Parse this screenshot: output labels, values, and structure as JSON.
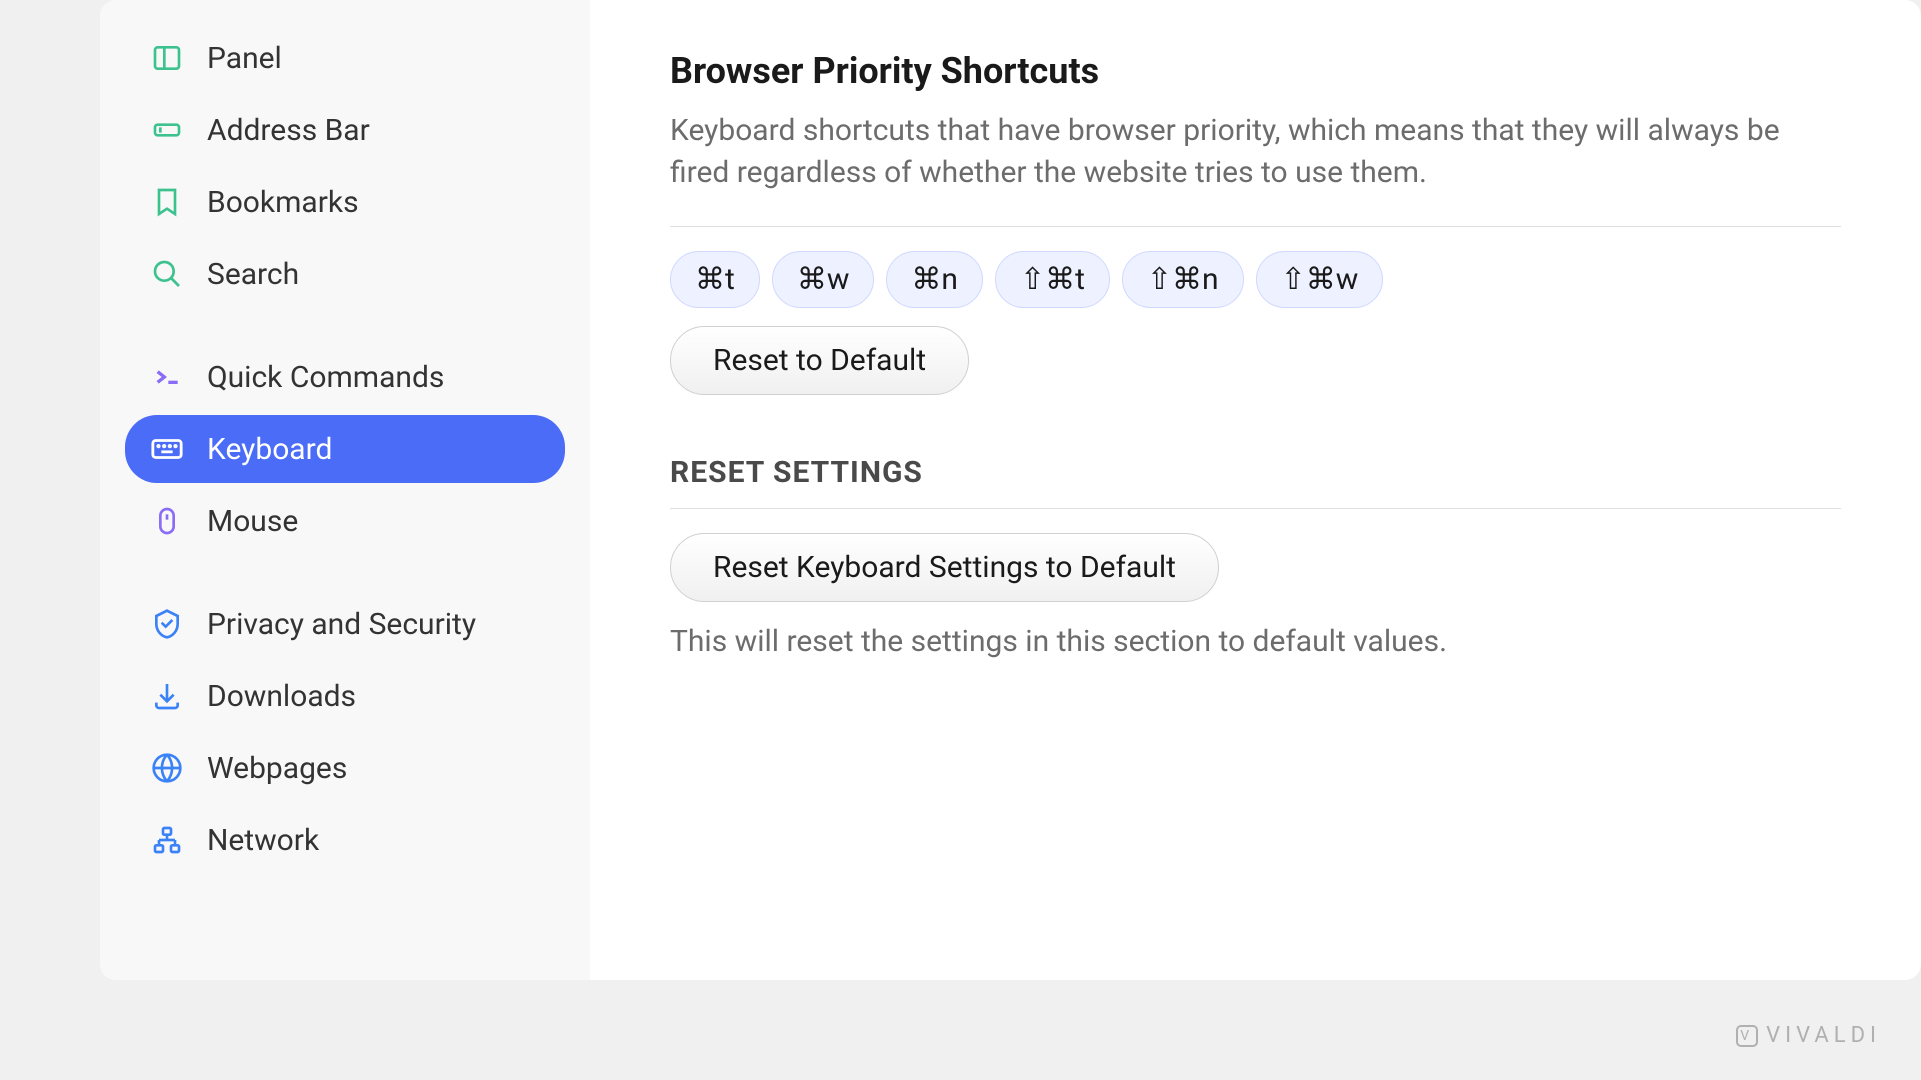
{
  "sidebar": {
    "group1": [
      {
        "label": "Panel",
        "icon": "panel"
      },
      {
        "label": "Address Bar",
        "icon": "addressbar"
      },
      {
        "label": "Bookmarks",
        "icon": "bookmark"
      },
      {
        "label": "Search",
        "icon": "search"
      }
    ],
    "group2": [
      {
        "label": "Quick Commands",
        "icon": "quick"
      },
      {
        "label": "Keyboard",
        "icon": "keyboard",
        "active": true
      },
      {
        "label": "Mouse",
        "icon": "mouse"
      }
    ],
    "group3": [
      {
        "label": "Privacy and Security",
        "icon": "privacy"
      },
      {
        "label": "Downloads",
        "icon": "download"
      },
      {
        "label": "Webpages",
        "icon": "webpages"
      },
      {
        "label": "Network",
        "icon": "network"
      }
    ]
  },
  "main": {
    "priority_title": "Browser Priority Shortcuts",
    "priority_description": "Keyboard shortcuts that have browser priority, which means that they will always be fired regardless of whether the website tries to use them.",
    "shortcuts": [
      "⌘t",
      "⌘w",
      "⌘n",
      "⇧⌘t",
      "⇧⌘n",
      "⇧⌘w"
    ],
    "reset_default_btn": "Reset to Default",
    "reset_header": "RESET SETTINGS",
    "reset_keyboard_btn": "Reset Keyboard Settings to Default",
    "reset_note": "This will reset the settings in this section to default values."
  },
  "brand": "VIVALDI"
}
